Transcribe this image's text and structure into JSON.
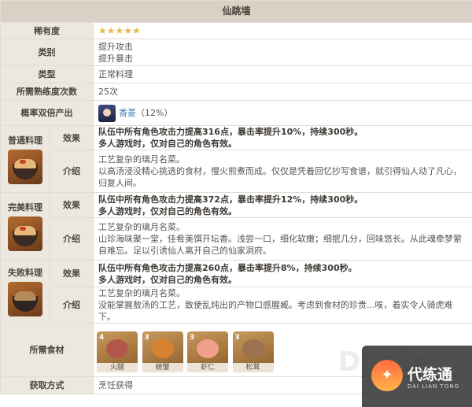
{
  "title": "仙跳墙",
  "rarity": {
    "label": "稀有度",
    "stars": "★★★★★"
  },
  "category": {
    "label": "类别",
    "lines": [
      "提升攻击",
      "提升暴击"
    ]
  },
  "type": {
    "label": "类型",
    "value": "正常料理"
  },
  "proficiency": {
    "label": "所需熟练度次数",
    "value": "25次"
  },
  "double_output": {
    "label": "概率双倍产出",
    "name": "香菱",
    "chance": "（12%）"
  },
  "variants": [
    {
      "label": "普通料理",
      "effect_label": "效果",
      "effect_lines": [
        "队伍中所有角色攻击力提高316点，暴击率提升10%，持续300秒。",
        "多人游戏时，仅对自己的角色有效。"
      ],
      "intro_label": "介绍",
      "intro_lines": [
        "工艺复杂的璃月名菜。",
        "以高汤浸没精心挑选的食材，慢火煎煮而成。仅仅是凭着回忆抄写食谱，就引得仙人动了凡心，",
        "归复人间。"
      ]
    },
    {
      "label": "完美料理",
      "effect_label": "效果",
      "effect_lines": [
        "队伍中所有角色攻击力提高372点，暴击率提升12%，持续300秒。",
        "多人游戏时，仅对自己的角色有效。"
      ],
      "intro_label": "介绍",
      "intro_lines": [
        "工艺复杂的璃月名菜。",
        "山珍海味聚一堂，佳肴美馔开坛香。浅尝一口，细化软嫩；细抿几分，回味悠长。从此魂牵梦萦",
        "自难忘。足以引诱仙人离开自己的仙家洞府。"
      ]
    },
    {
      "label": "失败料理",
      "effect_label": "效果",
      "effect_lines": [
        "队伍中所有角色攻击力提高260点，暴击率提升8%，持续300秒。",
        "多人游戏时，仅对自己的角色有效。"
      ],
      "intro_label": "介绍",
      "intro_lines": [
        "工艺复杂的璃月名菜。",
        "没能掌握敖汤的工艺，致使乱炖出的产物口感腥臧。考虑到食材的珍贵...唉，着实令人骑虎难下。"
      ]
    }
  ],
  "ingredients": {
    "label": "所需食材",
    "items": [
      {
        "count": "4",
        "name": "火腿",
        "color": "#b0574a"
      },
      {
        "count": "3",
        "name": "螃蟹",
        "color": "#d6822e"
      },
      {
        "count": "3",
        "name": "虾仁",
        "color": "#f0a08a"
      },
      {
        "count": "3",
        "name": "松茸",
        "color": "#9b7350"
      }
    ]
  },
  "source": {
    "label": "获取方式",
    "value": "烹饪获得"
  },
  "watermark": {
    "cn": "代练通",
    "en": "DAI LIAN TONG",
    "ghost": "DuoTe"
  }
}
